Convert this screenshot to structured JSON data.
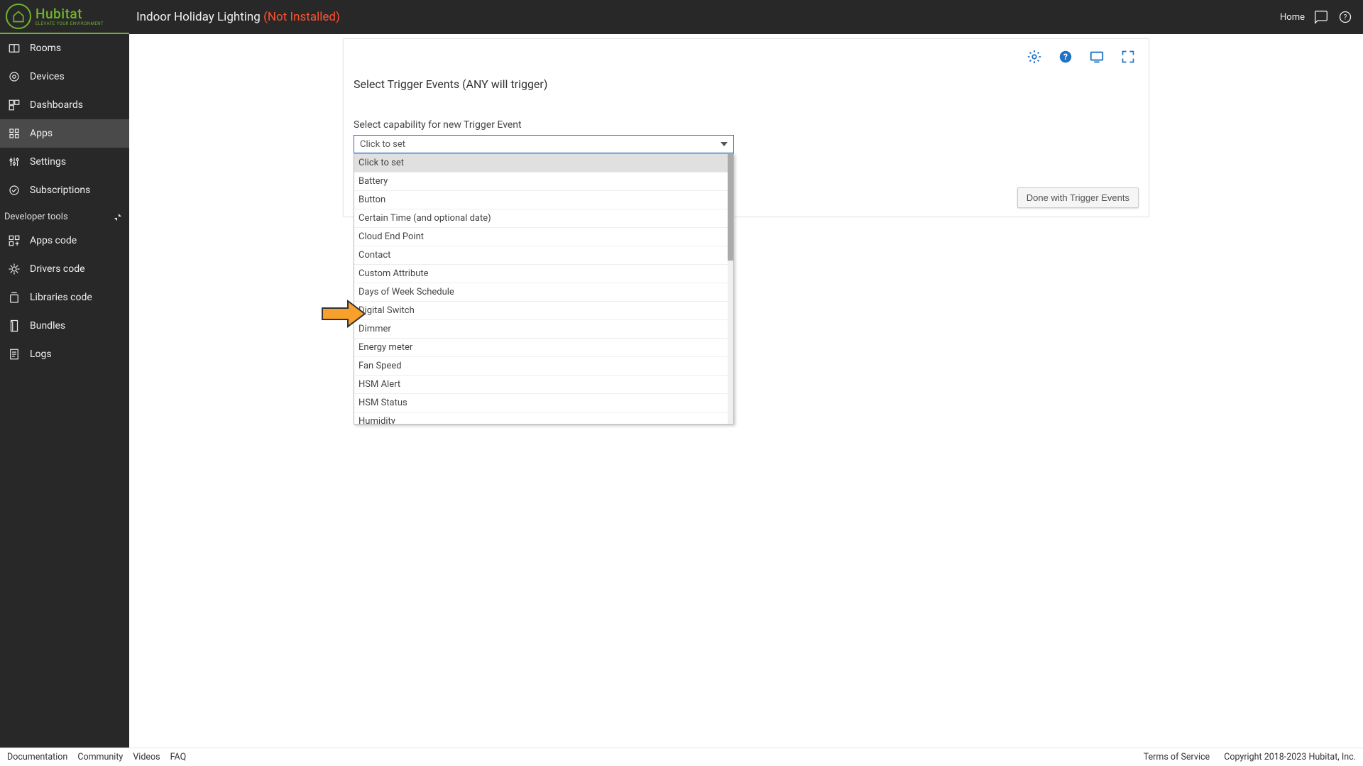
{
  "brand": {
    "name": "Hubitat",
    "tagline": "ELEVATE YOUR ENVIRONMENT"
  },
  "header": {
    "title": "Indoor Holiday Lighting",
    "status": "(Not Installed)",
    "home_label": "Home"
  },
  "sidebar": {
    "items": [
      {
        "label": "Rooms"
      },
      {
        "label": "Devices"
      },
      {
        "label": "Dashboards"
      },
      {
        "label": "Apps"
      },
      {
        "label": "Settings"
      },
      {
        "label": "Subscriptions"
      }
    ],
    "dev_section": "Developer tools",
    "dev_items": [
      {
        "label": "Apps code"
      },
      {
        "label": "Drivers code"
      },
      {
        "label": "Libraries code"
      },
      {
        "label": "Bundles"
      },
      {
        "label": "Logs"
      }
    ]
  },
  "card": {
    "heading": "Select Trigger Events (ANY will trigger)",
    "field_label": "Select capability for new Trigger Event",
    "select_value": "Click to set",
    "options": [
      "Click to set",
      "Battery",
      "Button",
      "Certain Time (and optional date)",
      "Cloud End Point",
      "Contact",
      "Custom Attribute",
      "Days of Week Schedule",
      "Digital Switch",
      "Dimmer",
      "Energy meter",
      "Fan Speed",
      "HSM Alert",
      "HSM Status",
      "Humidity"
    ],
    "done_label": "Done with Trigger Events"
  },
  "footer": {
    "left": [
      "Documentation",
      "Community",
      "Videos",
      "FAQ"
    ],
    "right": [
      "Terms of Service",
      "Copyright 2018-2023 Hubitat, Inc."
    ]
  }
}
